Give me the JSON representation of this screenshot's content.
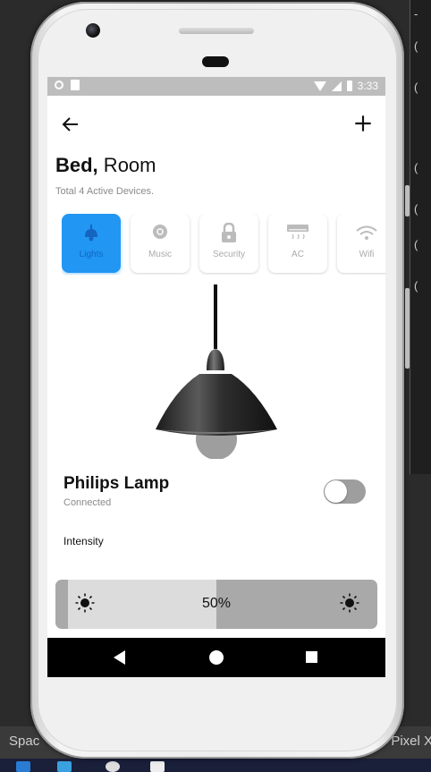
{
  "desktop": {
    "taskbar_left": "Spac",
    "taskbar_right": "Pixel X"
  },
  "status_bar": {
    "time": "3:33"
  },
  "header": {
    "title_bold": "Bed,",
    "title_rest": " Room",
    "subtitle": "Total 4 Active Devices."
  },
  "devices": [
    {
      "label": "Lights",
      "icon": "lamp-icon",
      "active": true
    },
    {
      "label": "Music",
      "icon": "speaker-icon",
      "active": false
    },
    {
      "label": "Security",
      "icon": "lock-icon",
      "active": false
    },
    {
      "label": "AC",
      "icon": "air-conditioner-icon",
      "active": false
    },
    {
      "label": "Wifi",
      "icon": "wifi-icon",
      "active": false
    }
  ],
  "selected_device": {
    "name": "Philips Lamp",
    "status": "Connected",
    "power_on": false
  },
  "intensity": {
    "label": "Intensity",
    "value_text": "50%",
    "value": 0.5
  },
  "colors": {
    "accent": "#2196f3",
    "toggle_off": "#9e9e9e",
    "slider_track": "#a9a9a9",
    "slider_fill": "#dcdcdc"
  }
}
